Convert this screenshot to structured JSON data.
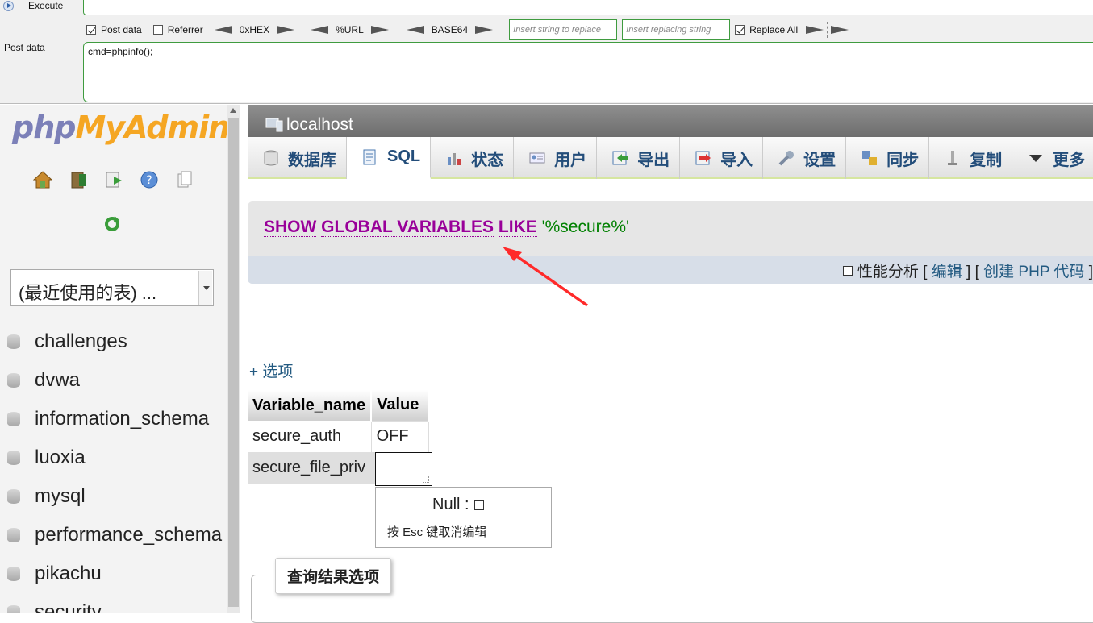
{
  "hackbar": {
    "execute_label": "Execute",
    "options": [
      {
        "label": "Post data",
        "checked": true
      },
      {
        "label": "Referrer",
        "checked": false
      }
    ],
    "encoders": [
      "0xHEX",
      "%URL",
      "BASE64"
    ],
    "replace_placeholder": "Insert string to replace",
    "replacing_placeholder": "Insert replacing string",
    "replace_all_label": "Replace All",
    "replace_all_checked": true,
    "post_label": "Post data",
    "post_value": "cmd=phpinfo();"
  },
  "logo": {
    "part1": "php",
    "part2": "MyAdmin"
  },
  "nav": {
    "icons": [
      "home-icon",
      "exit-icon",
      "query-window-icon",
      "help-icon",
      "docs-icon"
    ],
    "recent_tables": "(最近使用的表) ...",
    "databases": [
      "challenges",
      "dvwa",
      "information_schema",
      "luoxia",
      "mysql",
      "performance_schema",
      "pikachu",
      "security"
    ]
  },
  "server": {
    "name": "localhost"
  },
  "tabs": [
    {
      "label": "数据库",
      "icon": "database-icon"
    },
    {
      "label": "SQL",
      "icon": "sql-icon",
      "active": true
    },
    {
      "label": "状态",
      "icon": "status-icon"
    },
    {
      "label": "用户",
      "icon": "users-icon"
    },
    {
      "label": "导出",
      "icon": "export-icon"
    },
    {
      "label": "导入",
      "icon": "import-icon"
    },
    {
      "label": "设置",
      "icon": "settings-icon"
    },
    {
      "label": "同步",
      "icon": "sync-icon"
    },
    {
      "label": "复制",
      "icon": "replication-icon"
    },
    {
      "label": "更多",
      "icon": "more-icon"
    }
  ],
  "query": {
    "kw1": "SHOW",
    "kw2": "GLOBAL VARIABLES",
    "kw3": "LIKE",
    "string": "'%secure%'",
    "profiling": "性能分析",
    "edit": "编辑",
    "create_php": "创建 PHP 代码"
  },
  "results": {
    "options_link": "+ 选项",
    "columns": [
      "Variable_name",
      "Value"
    ],
    "rows": [
      {
        "name": "secure_auth",
        "value": "OFF"
      },
      {
        "name": "secure_file_priv",
        "value": ""
      }
    ],
    "null_label": "Null :",
    "esc_hint": "按 Esc 键取消编辑"
  },
  "query_result_options": "查询结果选项"
}
